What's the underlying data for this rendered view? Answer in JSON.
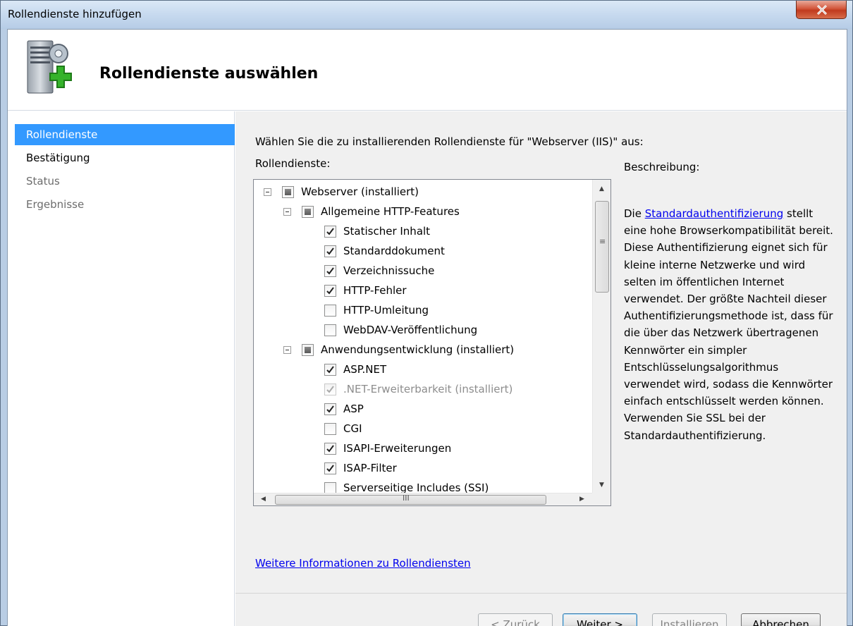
{
  "window": {
    "title": "Rollendienste hinzufügen",
    "close_icon": "close-icon"
  },
  "header": {
    "title": "Rollendienste auswählen",
    "icon": "server-add-icon"
  },
  "nav": {
    "items": [
      {
        "label": "Rollendienste",
        "state": "active"
      },
      {
        "label": "Bestätigung",
        "state": "normal"
      },
      {
        "label": "Status",
        "state": "disabled"
      },
      {
        "label": "Ergebnisse",
        "state": "disabled"
      }
    ]
  },
  "main": {
    "instruction": "Wählen Sie die zu installierenden Rollendienste für \"Webserver (IIS)\" aus:",
    "roles_label": "Rollendienste:",
    "description_label": "Beschreibung:",
    "tree": [
      {
        "label": "Webserver (installiert)",
        "level": 0,
        "state": "partial",
        "expander": true
      },
      {
        "label": "Allgemeine HTTP-Features",
        "level": 1,
        "state": "partial",
        "expander": true
      },
      {
        "label": "Statischer Inhalt",
        "level": 2,
        "state": "checked"
      },
      {
        "label": "Standarddokument",
        "level": 2,
        "state": "checked"
      },
      {
        "label": "Verzeichnissuche",
        "level": 2,
        "state": "checked"
      },
      {
        "label": "HTTP-Fehler",
        "level": 2,
        "state": "checked"
      },
      {
        "label": "HTTP-Umleitung",
        "level": 2,
        "state": "unchecked"
      },
      {
        "label": "WebDAV-Veröffentlichung",
        "level": 2,
        "state": "unchecked"
      },
      {
        "label": "Anwendungsentwicklung (installiert)",
        "level": 1,
        "state": "partial",
        "expander": true
      },
      {
        "label": "ASP.NET",
        "level": 2,
        "state": "checked"
      },
      {
        "label": ".NET-Erweiterbarkeit (installiert)",
        "level": 2,
        "state": "checked-disabled"
      },
      {
        "label": "ASP",
        "level": 2,
        "state": "checked"
      },
      {
        "label": "CGI",
        "level": 2,
        "state": "unchecked"
      },
      {
        "label": "ISAPI-Erweiterungen",
        "level": 2,
        "state": "checked"
      },
      {
        "label": "ISAP-Filter",
        "level": 2,
        "state": "checked"
      },
      {
        "label": "Serverseitige Includes (SSI)",
        "level": 2,
        "state": "unchecked"
      }
    ],
    "scrollbar_grip": "≡",
    "hscroll_grip": "III",
    "description": {
      "prefix": "Die ",
      "link": "Standardauthentifizierung",
      "text": " stellt eine hohe Browserkompatibilität bereit. Diese Authentifizierung eignet sich für kleine interne Netzwerke und wird selten im öffentlichen Internet verwendet. Der größte Nachteil dieser Authentifizierungsmethode ist, dass für die über das Netzwerk übertragenen Kennwörter ein simpler Entschlüsselungsalgorithmus verwendet wird, sodass die Kennwörter einfach entschlüsselt werden können. Verwenden Sie SSL bei der Standardauthentifizierung."
    },
    "more_info_link": "Weitere Informationen zu Rollendiensten"
  },
  "footer": {
    "back": "< Zurück",
    "next": "Weiter >",
    "install": "Installieren",
    "cancel": "Abbrechen"
  },
  "colors": {
    "selection": "#3399ff",
    "link": "#0000ee",
    "panel_bg": "#f0f0f0",
    "chrome": "#b9cde4"
  }
}
